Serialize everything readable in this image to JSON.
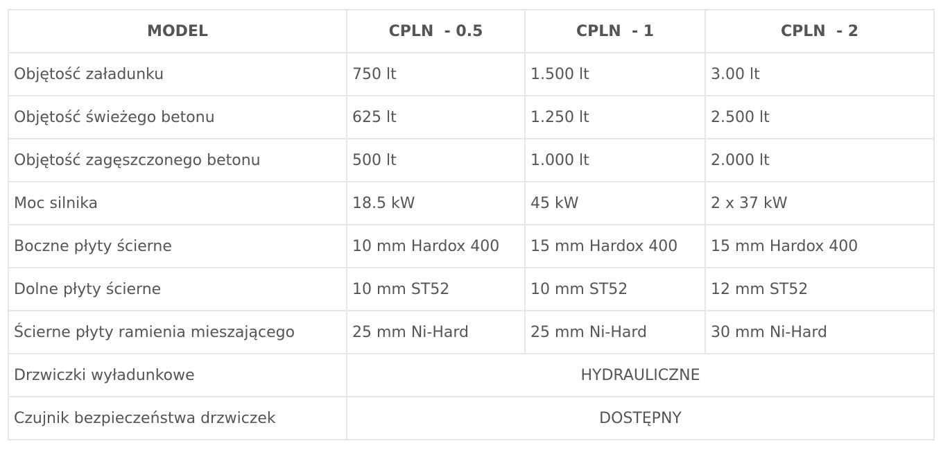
{
  "table": {
    "headers": [
      "MODEL",
      "CPLN  - 0.5",
      "CPLN  - 1",
      "CPLN  - 2"
    ],
    "rows": [
      {
        "label": "Objętość załadunku",
        "values": [
          "750 lt",
          "1.500 lt",
          "3.00 lt"
        ]
      },
      {
        "label": "Objętość świeżego betonu",
        "values": [
          "625 lt",
          "1.250 lt",
          "2.500 lt"
        ]
      },
      {
        "label": "Objętość zagęszczonego betonu",
        "values": [
          "500 lt",
          "1.000 lt",
          "2.000 lt"
        ]
      },
      {
        "label": "Moc silnika",
        "values": [
          "18.5 kW",
          "45 kW",
          "2 x 37 kW"
        ]
      },
      {
        "label": "Boczne płyty ścierne",
        "values": [
          "10 mm Hardox 400",
          "15 mm Hardox 400",
          "15 mm Hardox 400"
        ]
      },
      {
        "label": "Dolne płyty ścierne",
        "values": [
          "10 mm ST52",
          "10 mm ST52",
          "12 mm ST52"
        ]
      },
      {
        "label": "Ścierne płyty ramienia mieszającego",
        "values": [
          "25 mm Ni-Hard",
          "25 mm Ni-Hard",
          "30 mm Ni-Hard"
        ]
      }
    ],
    "merged_rows": [
      {
        "label": "Drzwiczki wyładunkowe",
        "value": "HYDRAULICZNE"
      },
      {
        "label": "Czujnik bezpieczeństwa drzwiczek",
        "value": "DOSTĘPNY"
      }
    ]
  },
  "colors": {
    "text": "#555555",
    "border": "#e6e6e6",
    "background": "#ffffff"
  }
}
